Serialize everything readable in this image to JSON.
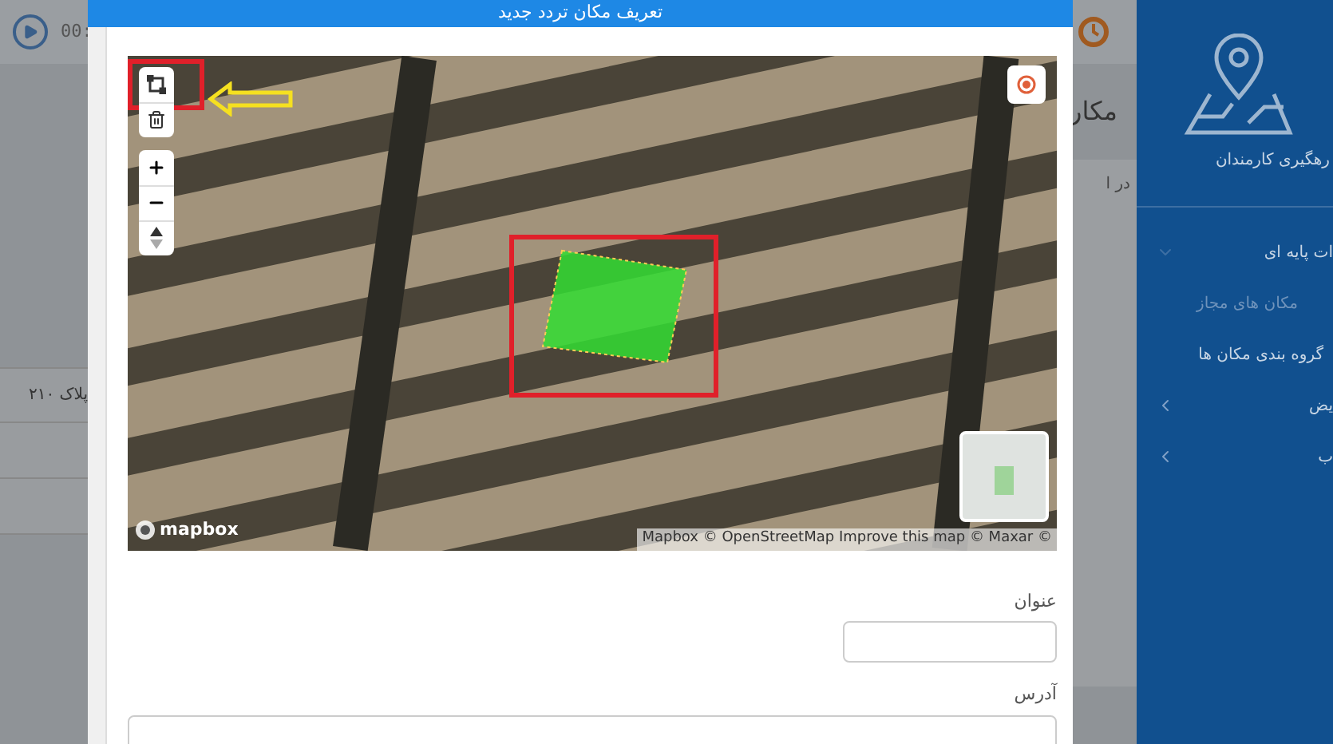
{
  "player": {
    "time": "00:"
  },
  "background_page": {
    "title": "مکار",
    "text": "در ا",
    "table_cell": "پلاک ۲۱۰"
  },
  "sidebar": {
    "brand": "رهگیری کارمندان",
    "items": [
      {
        "label": "ات پایه ای",
        "kind": "group",
        "expanded": true
      },
      {
        "label": "مکان های مجاز",
        "kind": "link",
        "selected": true
      },
      {
        "label": "گروه بندی مکان ها",
        "kind": "link",
        "selected": false
      },
      {
        "label": "یض",
        "kind": "group",
        "expanded": false
      },
      {
        "label": "ب",
        "kind": "group",
        "expanded": false
      }
    ]
  },
  "dialog": {
    "title": "تعریف مکان تردد جدید",
    "map": {
      "logo": "mapbox",
      "attribution": "Mapbox © OpenStreetMap Improve this map © Maxar ©"
    },
    "fields": [
      {
        "label": "عنوان",
        "kind": "input"
      },
      {
        "label": "آدرس",
        "kind": "textarea"
      }
    ]
  }
}
